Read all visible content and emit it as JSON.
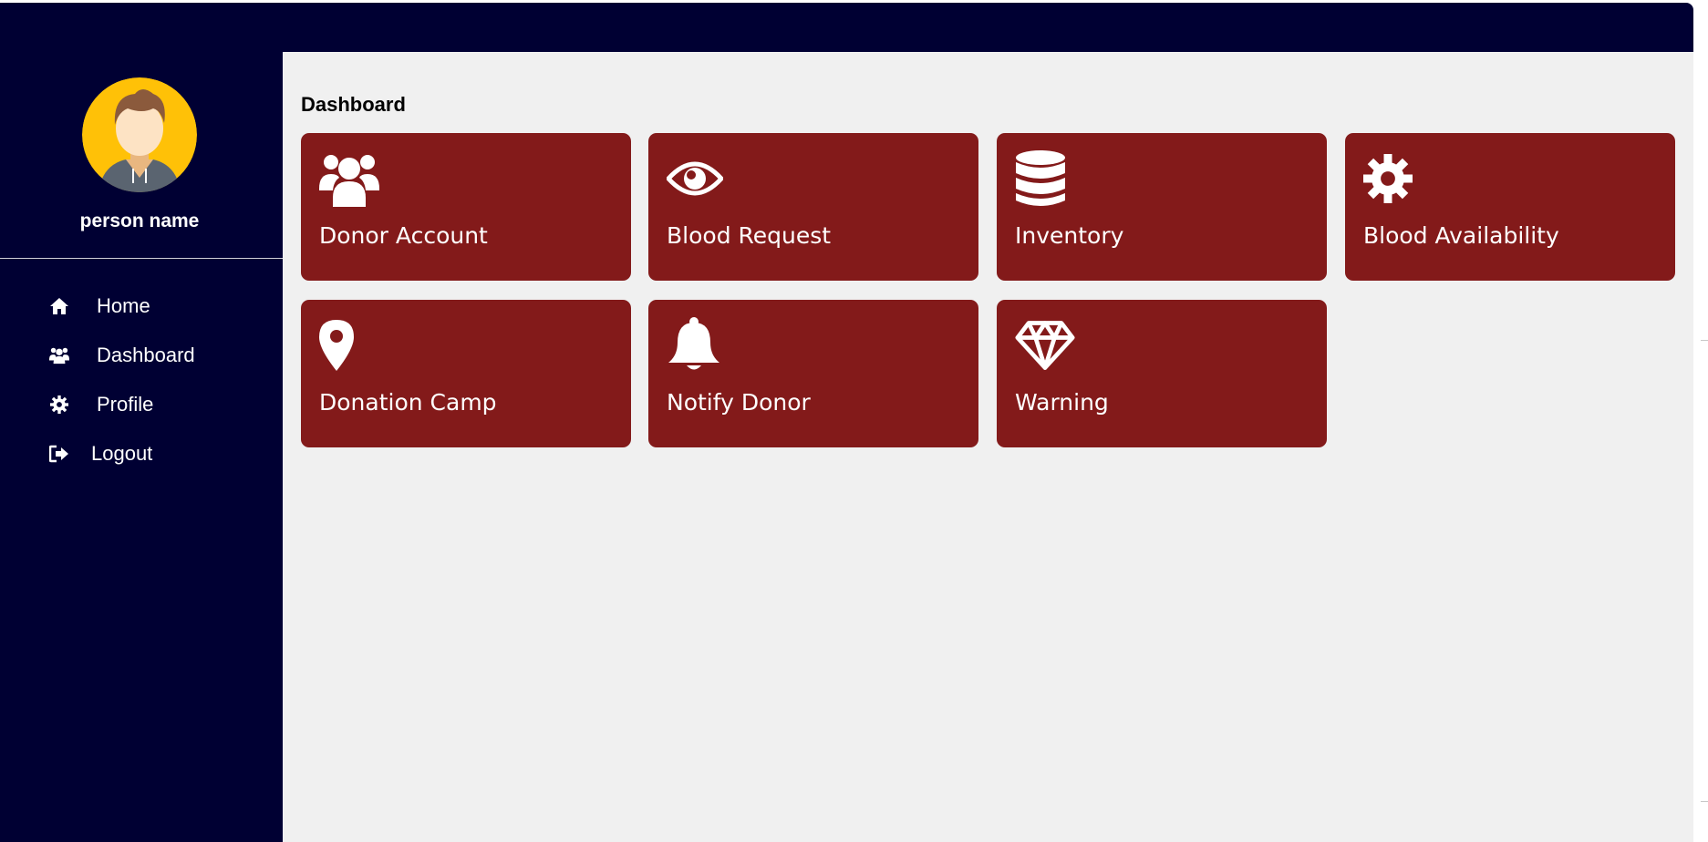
{
  "sidebar": {
    "user_name": "person name",
    "avatar_icon": "user-avatar-icon",
    "nav": [
      {
        "label": "Home",
        "icon": "home-icon"
      },
      {
        "label": "Dashboard",
        "icon": "users-icon"
      },
      {
        "label": "Profile",
        "icon": "gear-icon"
      },
      {
        "label": "Logout",
        "icon": "sign-out-icon"
      }
    ]
  },
  "main": {
    "title": "Dashboard",
    "cards": [
      {
        "label": "Donor Account",
        "icon": "users-icon"
      },
      {
        "label": "Blood Request",
        "icon": "eye-icon"
      },
      {
        "label": "Inventory",
        "icon": "database-icon"
      },
      {
        "label": "Blood Availability",
        "icon": "gear-icon"
      },
      {
        "label": "Donation Camp",
        "icon": "map-marker-icon"
      },
      {
        "label": "Notify Donor",
        "icon": "bell-icon"
      },
      {
        "label": "Warning",
        "icon": "diamond-icon"
      }
    ]
  },
  "colors": {
    "sidebar_bg": "#000033",
    "main_bg": "#f0f0f0",
    "card_bg": "#831a1a",
    "text_light": "#ffffff"
  }
}
